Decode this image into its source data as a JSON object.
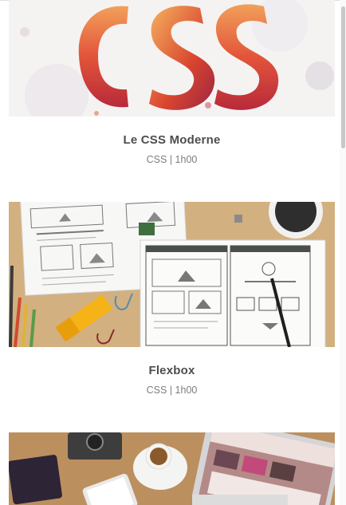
{
  "courses": [
    {
      "title": "Le CSS Moderne",
      "meta": "CSS | 1h00",
      "image": "css-lettering-image"
    },
    {
      "title": "Flexbox",
      "meta": "CSS | 1h00",
      "image": "wireframe-sketches-image"
    },
    {
      "title": "",
      "meta": "",
      "image": "laptop-desk-image"
    }
  ],
  "colors": {
    "title": "#4d4d4d",
    "meta": "#7d7d7d",
    "background": "#ffffff"
  }
}
